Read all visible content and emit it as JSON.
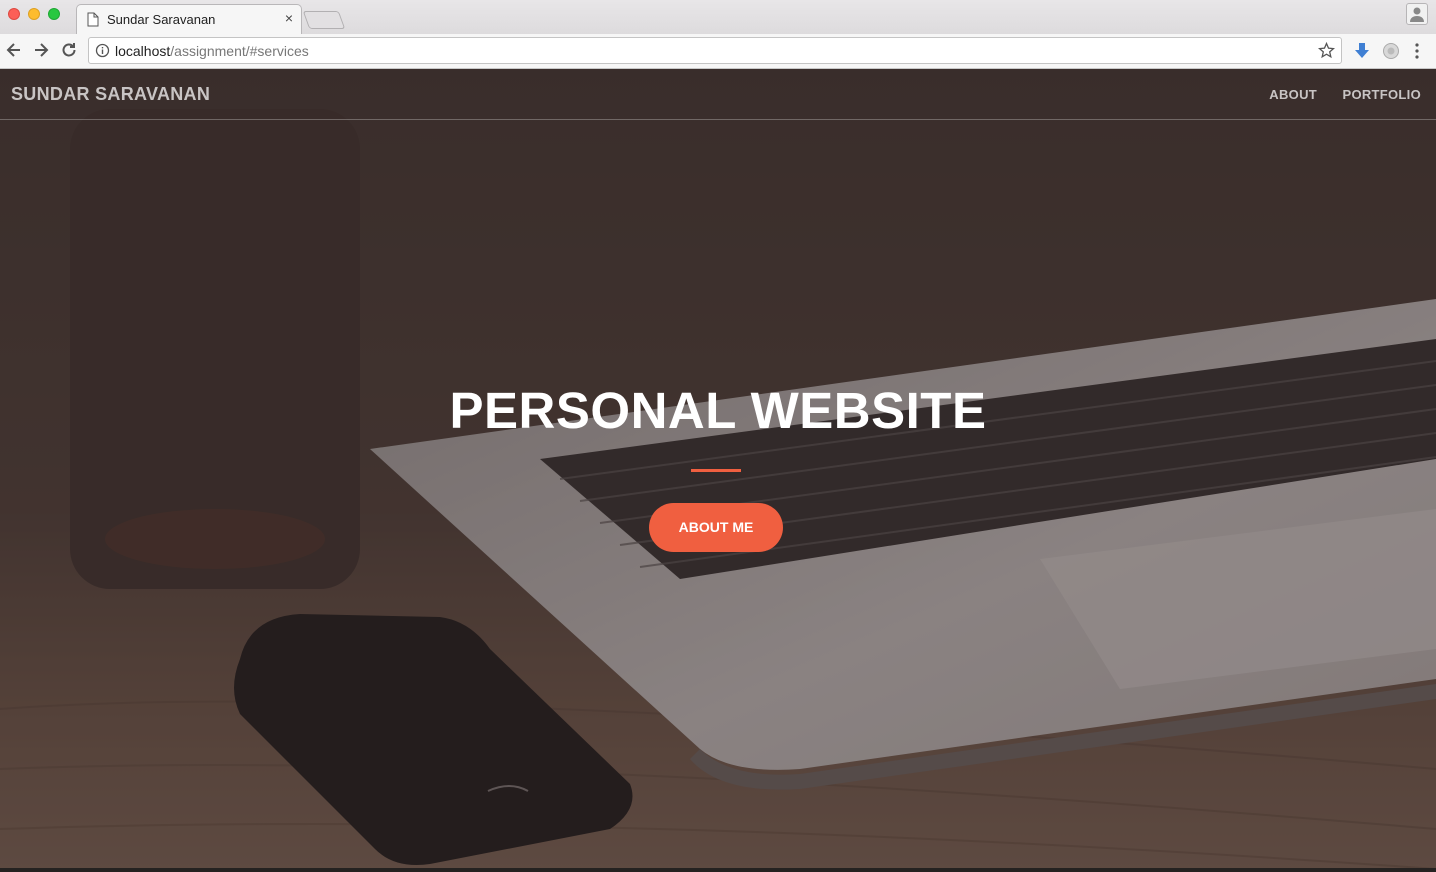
{
  "browser": {
    "tab_title": "Sundar Saravanan",
    "tab_close": "×",
    "url_host": "localhost",
    "url_path": "/assignment/#services"
  },
  "site": {
    "brand": "SUNDAR SARAVANAN",
    "nav": [
      {
        "label": "ABOUT"
      },
      {
        "label": "PORTFOLIO"
      }
    ]
  },
  "hero": {
    "title": "PERSONAL WEBSITE",
    "button_label": "ABOUT ME"
  },
  "colors": {
    "accent": "#f05f40",
    "overlay": "#382c2a"
  },
  "icons": [
    "page-icon",
    "back-icon",
    "forward-icon",
    "reload-icon",
    "info-icon",
    "star-icon",
    "download-extension-icon",
    "extension-icon",
    "menu-icon",
    "profile-icon"
  ]
}
